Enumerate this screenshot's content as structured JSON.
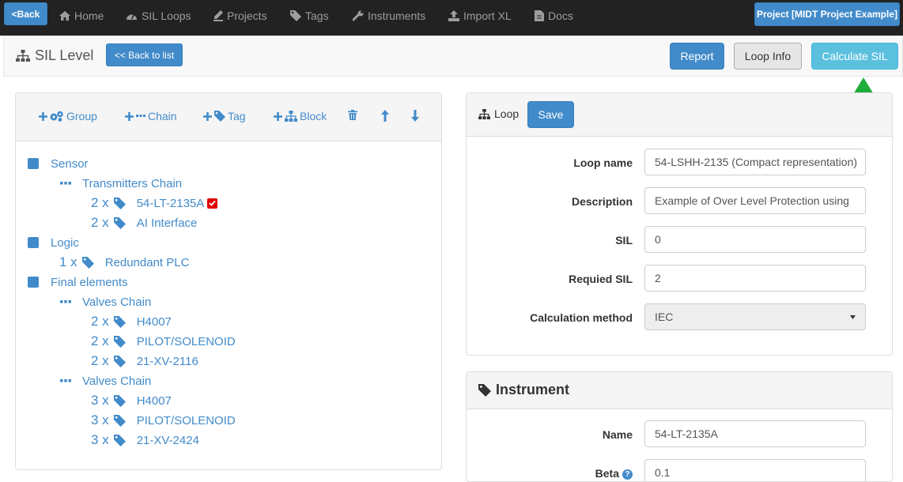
{
  "navbar": {
    "back_label": "<Back",
    "links": [
      {
        "label": "Home",
        "icon": "home-icon"
      },
      {
        "label": "SIL Loops",
        "icon": "gauge-icon"
      },
      {
        "label": "Projects",
        "icon": "edit-icon"
      },
      {
        "label": "Tags",
        "icon": "tags-icon"
      },
      {
        "label": "Instruments",
        "icon": "wrench-icon"
      },
      {
        "label": "Import XL",
        "icon": "upload-icon"
      },
      {
        "label": "Docs",
        "icon": "document-icon"
      }
    ],
    "project_label": "Project [MIDT Project Example]"
  },
  "toolbar": {
    "title": "SIL Level",
    "back_to_list": "<< Back to list",
    "report": "Report",
    "loop_info": "Loop Info",
    "calculate": "Calculate SIL"
  },
  "tree_panel": {
    "actions": [
      "Group",
      "Chain",
      "Tag",
      "Block"
    ],
    "items": [
      {
        "kind": "group",
        "label": "Sensor"
      },
      {
        "kind": "chain",
        "label": "Transmitters Chain"
      },
      {
        "kind": "tag",
        "qty": "2 x",
        "label": "54-LT-2135A",
        "checked": true
      },
      {
        "kind": "tag",
        "qty": "2 x",
        "label": "AI Interface"
      },
      {
        "kind": "group",
        "label": "Logic"
      },
      {
        "kind": "tag",
        "qty": "1 x",
        "label": "Redundant PLC"
      },
      {
        "kind": "group",
        "label": "Final elements"
      },
      {
        "kind": "chain",
        "label": "Valves Chain"
      },
      {
        "kind": "tag",
        "qty": "2 x",
        "label": "H4007"
      },
      {
        "kind": "tag",
        "qty": "2 x",
        "label": "PILOT/SOLENOID"
      },
      {
        "kind": "tag",
        "qty": "2 x",
        "label": "21-XV-2116"
      },
      {
        "kind": "chain",
        "label": "Valves Chain"
      },
      {
        "kind": "tag",
        "qty": "3 x",
        "label": "H4007"
      },
      {
        "kind": "tag",
        "qty": "3 x",
        "label": "PILOT/SOLENOID"
      },
      {
        "kind": "tag",
        "qty": "3 x",
        "label": "21-XV-2424"
      }
    ]
  },
  "loop_panel": {
    "title": "Loop",
    "save": "Save",
    "fields": [
      {
        "label": "Loop name",
        "value": "54-LSHH-2135 (Compact representation)"
      },
      {
        "label": "Description",
        "value": "Example of Over Level Protection using"
      },
      {
        "label": "SIL",
        "value": "0"
      },
      {
        "label": "Requied SIL",
        "value": "2"
      },
      {
        "label": "Calculation method",
        "value": "IEC"
      }
    ]
  },
  "instrument_panel": {
    "title": "Instrument",
    "fields": [
      {
        "label": "Name",
        "value": "54-LT-2135A"
      },
      {
        "label": "Beta",
        "value": "0.1"
      }
    ]
  },
  "colors": {
    "primary": "#428bca",
    "info": "#5bc0de",
    "navbar": "#222222",
    "arrow": "#1fad3c",
    "check": "#e00000"
  }
}
